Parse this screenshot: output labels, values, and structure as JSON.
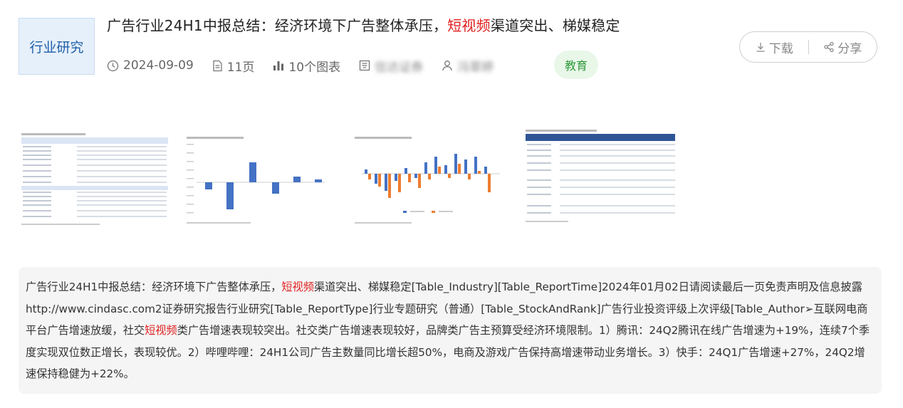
{
  "category_badge": "行业研究",
  "title": {
    "before": "广告行业24H1中报总结：经济环境下广告整体承压，",
    "highlight": "短视频",
    "after": "渠道突出、梯媒稳定"
  },
  "meta": {
    "date": "2024-09-09",
    "pages": "11页",
    "charts": "10个图表",
    "institution": "信达证券",
    "author": "冯翠婷"
  },
  "tag": "教育",
  "actions": {
    "download": "下载",
    "share": "分享"
  },
  "summary": {
    "part1": "广告行业24H1中报总结：经济环境下广告整体承压，",
    "hl1": "短视频",
    "part2": "渠道突出、梯媒稳定[Table_Industry][Table_ReportTime]2024年01月02日请阅读最后一页免责声明及信息披露http://www.cindasc.com2证券研究报告行业研究[Table_ReportType]行业专题研究（普通）[Table_StockAndRank]广告行业投资评级上次评级[Table_Author➢互联网电商平台广告增速放缓，社交",
    "hl2": "短视频",
    "part3": "类广告增速表现较突出。社交类广告增速表现较好，品牌类广告主预算受经济环境限制。1）腾讯：24Q2腾讯在线广告增速为+19%，连续7个季度实现双位数正增长，表现较优。2）哔哩哔哩：24H1公司广告主数量同比增长超50%，电商及游戏广告保持高增速带动业务增长。3）快手：24Q1广告增速+27%，24Q2增速保持稳健为+22%。"
  },
  "colors": {
    "highlight": "#e0201f",
    "bar_blue": "#4472c4",
    "bar_orange": "#ed7d31",
    "tag_green": "#2f9a3a"
  },
  "icons": [
    "clock-icon",
    "document-icon",
    "bar-chart-icon",
    "institution-icon",
    "user-icon",
    "download-icon",
    "share-icon"
  ]
}
